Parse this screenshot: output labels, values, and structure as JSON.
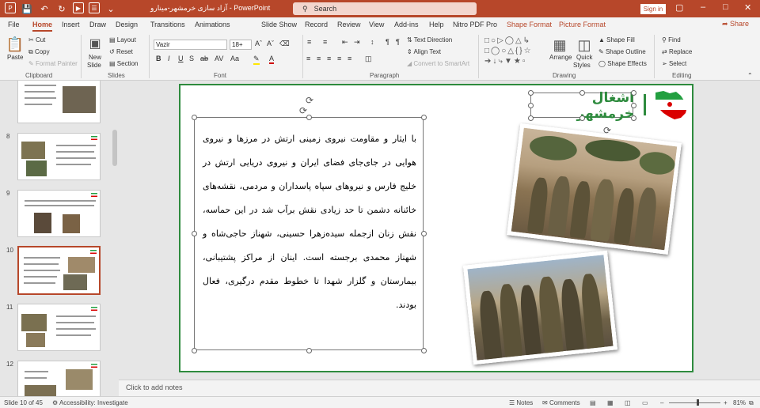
{
  "window": {
    "title": "آزاد سازی خرمشهر-مینارو",
    "app": "PowerPoint",
    "search_placeholder": "Search",
    "sign_in": "Sign in",
    "share": "Share"
  },
  "tabs": [
    "File",
    "Home",
    "Insert",
    "Draw",
    "Design",
    "Transitions",
    "Animations",
    "Slide Show",
    "Record",
    "Review",
    "View",
    "Add-ins",
    "Help",
    "Nitro PDF Pro",
    "Shape Format",
    "Picture Format"
  ],
  "ribbon": {
    "clipboard": {
      "paste": "Paste",
      "cut": "Cut",
      "copy": "Copy",
      "format_painter": "Format Painter",
      "label": "Clipboard"
    },
    "slides": {
      "new_slide": "New",
      "new_slide2": "Slide",
      "layout": "Layout",
      "reset": "Reset",
      "section": "Section",
      "label": "Slides"
    },
    "font": {
      "name": "Vazir",
      "size": "18+",
      "label": "Font"
    },
    "paragraph": {
      "text_direction": "Text Direction",
      "align_text": "Align Text",
      "convert_smartart": "Convert to SmartArt",
      "label": "Paragraph"
    },
    "drawing": {
      "arrange": "Arrange",
      "quick_styles": "Quick",
      "quick_styles2": "Styles",
      "shape_fill": "Shape Fill",
      "shape_outline": "Shape Outline",
      "shape_effects": "Shape Effects",
      "label": "Drawing"
    },
    "editing": {
      "find": "Find",
      "replace": "Replace",
      "select": "Select",
      "label": "Editing"
    }
  },
  "thumbnails": [
    {
      "num": ""
    },
    {
      "num": "8"
    },
    {
      "num": "9"
    },
    {
      "num": "10"
    },
    {
      "num": "11"
    },
    {
      "num": "12"
    }
  ],
  "slide": {
    "title": "اشغال خرمشهر",
    "body": "با ایثار و مقاومت نیروی زمینی ارتش در مرزها و نیروی هوایی در جای‌جای فضای ایران و نیروی دریایی ارتش در خلیج فارس و نیروهای سپاه پاسداران و مردمی، نقشه‌های خائنانه دشمن تا حد زیادی نقش برآب شد در این حماسه، نقش زنان ازجمله سیده‌زهرا حسینی، شهناز حاجی‌شاه و شهناز محمدی برجسته است. اینان از مراکز پشتیبانی، بیمارستان و گلزار شهدا تا خطوط مقدم درگیری، فعال بودند."
  },
  "notes_placeholder": "Click to add notes",
  "status": {
    "slide_info": "Slide 10 of 45",
    "accessibility": "Accessibility: Investigate",
    "notes": "Notes",
    "comments": "Comments",
    "zoom": "81%",
    "zoom_fraction": 0.55
  },
  "colors": {
    "accent": "#b7472a",
    "slide_green": "#2e8b3e"
  }
}
